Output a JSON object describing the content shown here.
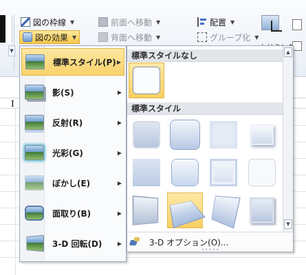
{
  "ribbon": {
    "border_label": "図の枠線",
    "effects_label": "図の効果",
    "bring_forward_label": "前面へ移動",
    "send_backward_label": "背面へ移動",
    "align_label": "配置",
    "group_label": "グループ化",
    "crop_label": "トリミング"
  },
  "menu": {
    "items": [
      {
        "label": "標準スタイル(P)",
        "icon": "preset-style-icon"
      },
      {
        "label": "影(S)",
        "icon": "shadow-icon"
      },
      {
        "label": "反射(R)",
        "icon": "reflection-icon"
      },
      {
        "label": "光彩(G)",
        "icon": "glow-icon"
      },
      {
        "label": "ぼかし(E)",
        "icon": "soft-edges-icon"
      },
      {
        "label": "面取り(B)",
        "icon": "bevel-icon"
      },
      {
        "label": "3-D 回転(D)",
        "icon": "3d-rotation-icon"
      }
    ]
  },
  "gallery": {
    "section_none": "標準スタイルなし",
    "section_presets": "標準スタイル",
    "footer_label": "3-D オプション(O)..."
  },
  "sheet": {
    "cursor_glyph": "I"
  },
  "colors": {
    "highlight": "#f9d26b",
    "menu_border": "#a0a9b8"
  }
}
